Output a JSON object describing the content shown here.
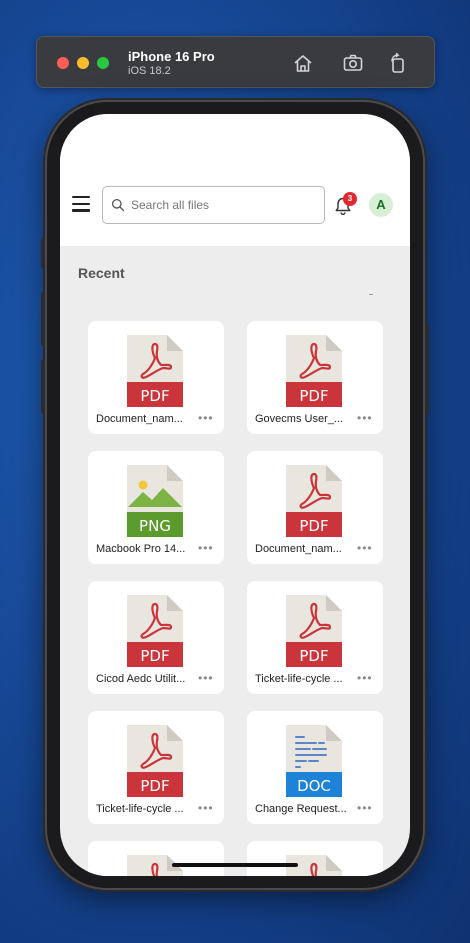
{
  "simulator": {
    "device_name": "iPhone 16 Pro",
    "os_version": "iOS 18.2",
    "buttons": [
      "home-icon",
      "screenshot-icon",
      "rotate-icon"
    ]
  },
  "header": {
    "search_placeholder": "Search all files",
    "notification_count": "3",
    "avatar_initial": "A"
  },
  "section": {
    "title": "Recent"
  },
  "files": [
    {
      "name": "Document_nam...",
      "type": "PDF"
    },
    {
      "name": "Govecms User_...",
      "type": "PDF"
    },
    {
      "name": "Macbook Pro 14...",
      "type": "PNG"
    },
    {
      "name": "Document_nam...",
      "type": "PDF"
    },
    {
      "name": "Cicod Aedc Utilit...",
      "type": "PDF"
    },
    {
      "name": "Ticket-life-cycle ...",
      "type": "PDF"
    },
    {
      "name": "Ticket-life-cycle ...",
      "type": "PDF"
    },
    {
      "name": "Change Request...",
      "type": "DOC"
    },
    {
      "name": "",
      "type": "PDF"
    },
    {
      "name": "",
      "type": "PDF"
    }
  ],
  "more_label": "•••",
  "colors": {
    "pdf": "#c9353a",
    "png": "#5b9a2c",
    "doc": "#1e82d6"
  }
}
